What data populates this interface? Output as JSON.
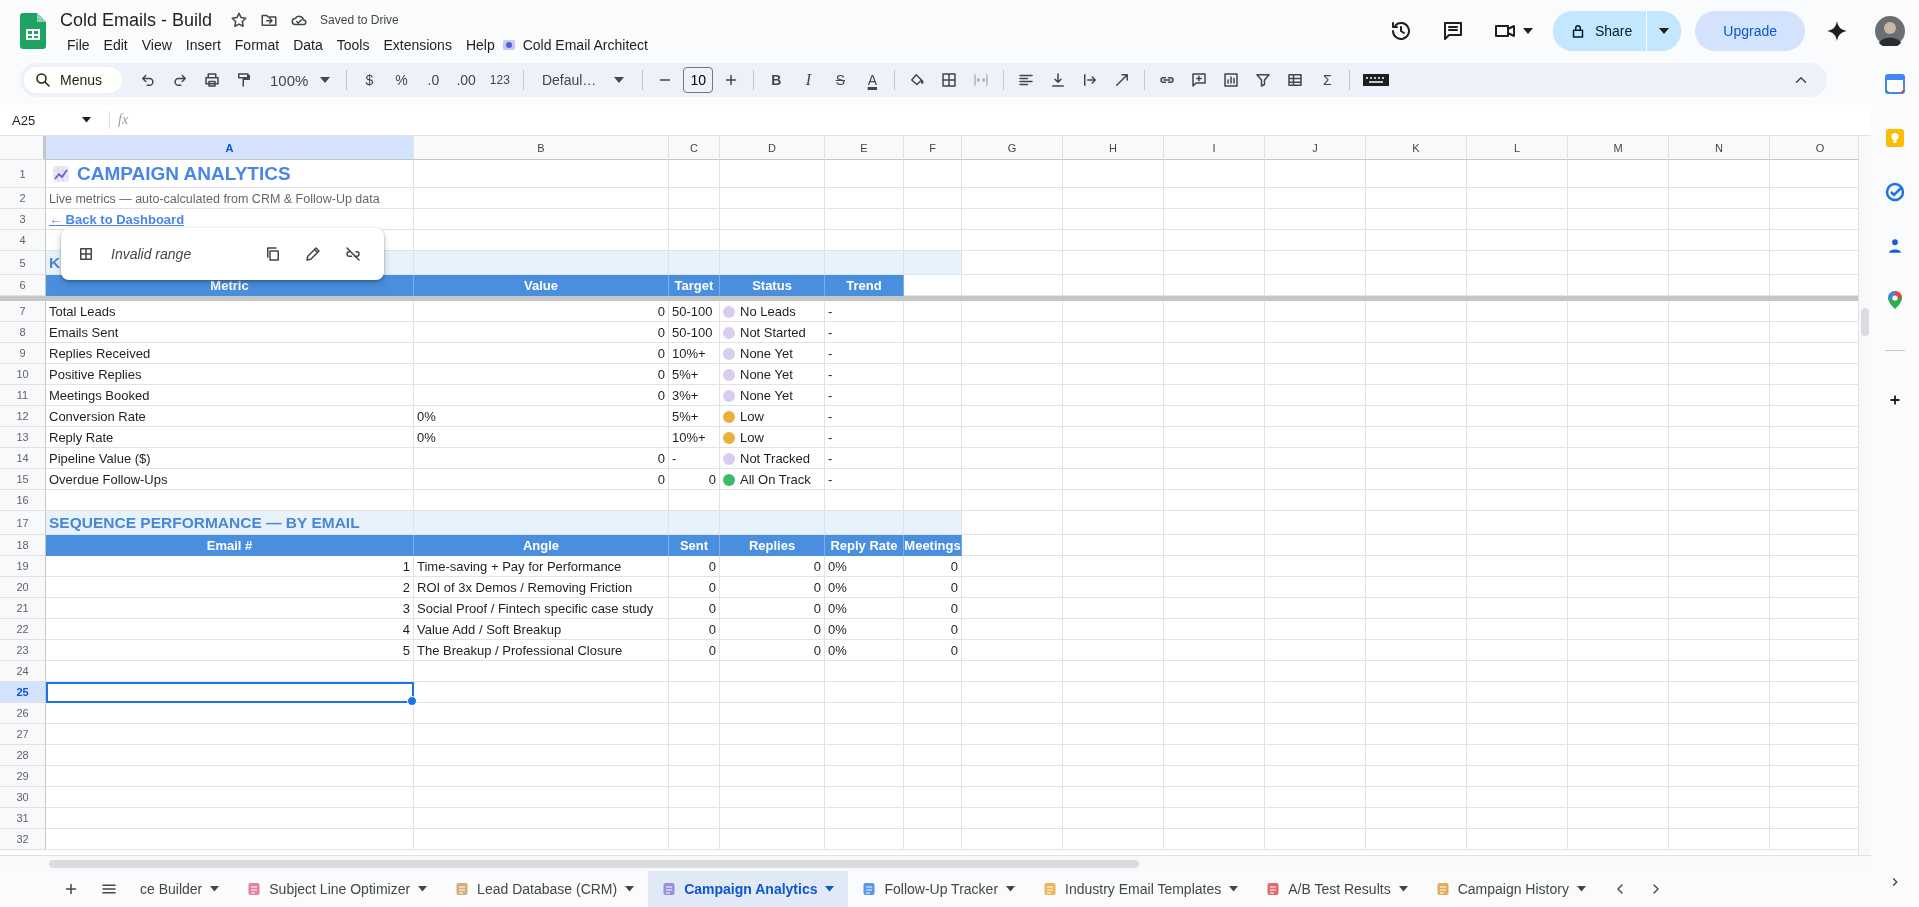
{
  "document": {
    "title": "Cold Emails - Build",
    "status": "Saved to Drive"
  },
  "menus": [
    "File",
    "Edit",
    "View",
    "Insert",
    "Format",
    "Data",
    "Tools",
    "Extensions",
    "Help"
  ],
  "addon_menu": "Cold Email Architect",
  "header": {
    "share": "Share",
    "upgrade": "Upgrade"
  },
  "toolbar": {
    "search_placeholder": "Menus",
    "zoom": "100%",
    "currency": "$",
    "percent": "%",
    "decrease_decimals": ".0",
    "increase_decimals": ".00",
    "more_formats": "123",
    "font": "Defaul…",
    "font_size": "10",
    "bold": "B",
    "italic": "I",
    "strikethrough": "S",
    "text_color": "A",
    "functions": "Σ"
  },
  "name_box": "A25",
  "formula_label": "fx",
  "link_popup": {
    "text": "Invalid range"
  },
  "columns": [
    {
      "label": "A",
      "selected": true
    },
    {
      "label": "B",
      "selected": false
    },
    {
      "label": "C",
      "selected": false
    },
    {
      "label": "D",
      "selected": false
    },
    {
      "label": "E",
      "selected": false
    },
    {
      "label": "F",
      "selected": false
    },
    {
      "label": "G",
      "selected": false
    },
    {
      "label": "H",
      "selected": false
    },
    {
      "label": "I",
      "selected": false
    },
    {
      "label": "J",
      "selected": false
    },
    {
      "label": "K",
      "selected": false
    },
    {
      "label": "L",
      "selected": false
    },
    {
      "label": "M",
      "selected": false
    },
    {
      "label": "N",
      "selected": false
    },
    {
      "label": "O",
      "selected": false
    }
  ],
  "rows": [
    {
      "number": "1",
      "selected": false,
      "kind": "title",
      "text": "CAMPAIGN ANALYTICS"
    },
    {
      "number": "2",
      "selected": false,
      "kind": "note",
      "text": "Live metrics — auto-calculated from CRM & Follow-Up data"
    },
    {
      "number": "3",
      "selected": false,
      "kind": "link",
      "text": "← Back to Dashboard"
    },
    {
      "number": "4",
      "selected": false,
      "kind": "blank"
    },
    {
      "number": "5",
      "selected": false,
      "kind": "section",
      "text": "K"
    },
    {
      "number": "6",
      "selected": false,
      "kind": "header",
      "cells": [
        "Metric",
        "Value",
        "Target",
        "Status",
        "Trend"
      ]
    },
    {
      "number": "7",
      "selected": false,
      "kind": "data",
      "cells": [
        {
          "kind": "text",
          "text": "Total Leads"
        },
        {
          "kind": "number",
          "text": "0"
        },
        {
          "kind": "text",
          "text": "50-100"
        },
        {
          "kind": "status",
          "text": "No Leads",
          "color": "#d9cdee"
        },
        {
          "kind": "text",
          "text": "-"
        }
      ]
    },
    {
      "number": "8",
      "selected": false,
      "kind": "data",
      "cells": [
        {
          "kind": "text",
          "text": "Emails Sent"
        },
        {
          "kind": "number",
          "text": "0"
        },
        {
          "kind": "text",
          "text": "50-100"
        },
        {
          "kind": "status",
          "text": "Not Started",
          "color": "#d9cdee"
        },
        {
          "kind": "text",
          "text": "-"
        }
      ]
    },
    {
      "number": "9",
      "selected": false,
      "kind": "data",
      "cells": [
        {
          "kind": "text",
          "text": "Replies Received"
        },
        {
          "kind": "number",
          "text": "0"
        },
        {
          "kind": "text",
          "text": "10%+"
        },
        {
          "kind": "status",
          "text": "None Yet",
          "color": "#d9cdee"
        },
        {
          "kind": "text",
          "text": "-"
        }
      ]
    },
    {
      "number": "10",
      "selected": false,
      "kind": "data",
      "cells": [
        {
          "kind": "text",
          "text": "Positive Replies"
        },
        {
          "kind": "number",
          "text": "0"
        },
        {
          "kind": "text",
          "text": "5%+"
        },
        {
          "kind": "status",
          "text": "None Yet",
          "color": "#d9cdee"
        },
        {
          "kind": "text",
          "text": "-"
        }
      ]
    },
    {
      "number": "11",
      "selected": false,
      "kind": "data",
      "cells": [
        {
          "kind": "text",
          "text": "Meetings Booked"
        },
        {
          "kind": "number",
          "text": "0"
        },
        {
          "kind": "text",
          "text": "3%+"
        },
        {
          "kind": "status",
          "text": "None Yet",
          "color": "#d9cdee"
        },
        {
          "kind": "text",
          "text": "-"
        }
      ]
    },
    {
      "number": "12",
      "selected": false,
      "kind": "data",
      "cells": [
        {
          "kind": "text",
          "text": "Conversion Rate"
        },
        {
          "kind": "text",
          "text": "0%"
        },
        {
          "kind": "text",
          "text": "5%+"
        },
        {
          "kind": "status",
          "text": "Low",
          "color": "#eab03c"
        },
        {
          "kind": "text",
          "text": "-"
        }
      ]
    },
    {
      "number": "13",
      "selected": false,
      "kind": "data",
      "cells": [
        {
          "kind": "text",
          "text": "Reply Rate"
        },
        {
          "kind": "text",
          "text": "0%"
        },
        {
          "kind": "text",
          "text": "10%+"
        },
        {
          "kind": "status",
          "text": "Low",
          "color": "#eab03c"
        },
        {
          "kind": "text",
          "text": "-"
        }
      ]
    },
    {
      "number": "14",
      "selected": false,
      "kind": "data",
      "cells": [
        {
          "kind": "text",
          "text": "Pipeline Value ($)"
        },
        {
          "kind": "number",
          "text": "0"
        },
        {
          "kind": "text",
          "text": "-"
        },
        {
          "kind": "status",
          "text": "Not Tracked",
          "color": "#d9cdee"
        },
        {
          "kind": "text",
          "text": "-"
        }
      ]
    },
    {
      "number": "15",
      "selected": false,
      "kind": "data",
      "cells": [
        {
          "kind": "text",
          "text": "Overdue Follow-Ups"
        },
        {
          "kind": "number",
          "text": "0"
        },
        {
          "kind": "number",
          "text": "0"
        },
        {
          "kind": "status",
          "text": "All On Track",
          "color": "#3dbb6c"
        },
        {
          "kind": "text",
          "text": "-"
        }
      ]
    },
    {
      "number": "16",
      "selected": false,
      "kind": "blank"
    },
    {
      "number": "17",
      "selected": false,
      "kind": "section",
      "text": "SEQUENCE PERFORMANCE — BY EMAIL"
    },
    {
      "number": "18",
      "selected": false,
      "kind": "header",
      "cells": [
        "Email #",
        "Angle",
        "Sent",
        "Replies",
        "Reply Rate",
        "Meetings"
      ]
    },
    {
      "number": "19",
      "selected": false,
      "kind": "data",
      "cells": [
        {
          "kind": "number",
          "text": "1"
        },
        {
          "kind": "text",
          "text": "Time-saving + Pay for Performance"
        },
        {
          "kind": "number",
          "text": "0"
        },
        {
          "kind": "number",
          "text": "0"
        },
        {
          "kind": "text",
          "text": "0%"
        },
        {
          "kind": "number",
          "text": "0"
        }
      ]
    },
    {
      "number": "20",
      "selected": false,
      "kind": "data",
      "cells": [
        {
          "kind": "number",
          "text": "2"
        },
        {
          "kind": "text",
          "text": "ROI of 3x Demos / Removing Friction"
        },
        {
          "kind": "number",
          "text": "0"
        },
        {
          "kind": "number",
          "text": "0"
        },
        {
          "kind": "text",
          "text": "0%"
        },
        {
          "kind": "number",
          "text": "0"
        }
      ]
    },
    {
      "number": "21",
      "selected": false,
      "kind": "data",
      "cells": [
        {
          "kind": "number",
          "text": "3"
        },
        {
          "kind": "text",
          "text": "Social Proof / Fintech specific case study"
        },
        {
          "kind": "number",
          "text": "0"
        },
        {
          "kind": "number",
          "text": "0"
        },
        {
          "kind": "text",
          "text": "0%"
        },
        {
          "kind": "number",
          "text": "0"
        }
      ]
    },
    {
      "number": "22",
      "selected": false,
      "kind": "data",
      "cells": [
        {
          "kind": "number",
          "text": "4"
        },
        {
          "kind": "text",
          "text": "Value Add / Soft Breakup"
        },
        {
          "kind": "number",
          "text": "0"
        },
        {
          "kind": "number",
          "text": "0"
        },
        {
          "kind": "text",
          "text": "0%"
        },
        {
          "kind": "number",
          "text": "0"
        }
      ]
    },
    {
      "number": "23",
      "selected": false,
      "kind": "data",
      "cells": [
        {
          "kind": "number",
          "text": "5"
        },
        {
          "kind": "text",
          "text": "The Breakup / Professional Closure"
        },
        {
          "kind": "number",
          "text": "0"
        },
        {
          "kind": "number",
          "text": "0"
        },
        {
          "kind": "text",
          "text": "0%"
        },
        {
          "kind": "number",
          "text": "0"
        }
      ]
    },
    {
      "number": "24",
      "selected": false,
      "kind": "blank"
    },
    {
      "number": "25",
      "selected": true,
      "kind": "blank"
    },
    {
      "number": "26",
      "selected": false,
      "kind": "blank"
    },
    {
      "number": "27",
      "selected": false,
      "kind": "blank"
    },
    {
      "number": "28",
      "selected": false,
      "kind": "blank"
    },
    {
      "number": "29",
      "selected": false,
      "kind": "blank"
    },
    {
      "number": "30",
      "selected": false,
      "kind": "blank"
    },
    {
      "number": "31",
      "selected": false,
      "kind": "blank"
    },
    {
      "number": "32",
      "selected": false,
      "kind": "blank"
    }
  ],
  "tabs": [
    {
      "label": "ce Builder",
      "selected": false
    },
    {
      "label": "Subject Line Optimizer",
      "selected": false
    },
    {
      "label": "Lead Database (CRM)",
      "selected": false
    },
    {
      "label": "Campaign Analytics",
      "selected": true
    },
    {
      "label": "Follow-Up Tracker",
      "selected": false
    },
    {
      "label": "Industry Email Templates",
      "selected": false
    },
    {
      "label": "A/B Test Results",
      "selected": false
    },
    {
      "label": "Campaign History",
      "selected": false
    }
  ]
}
